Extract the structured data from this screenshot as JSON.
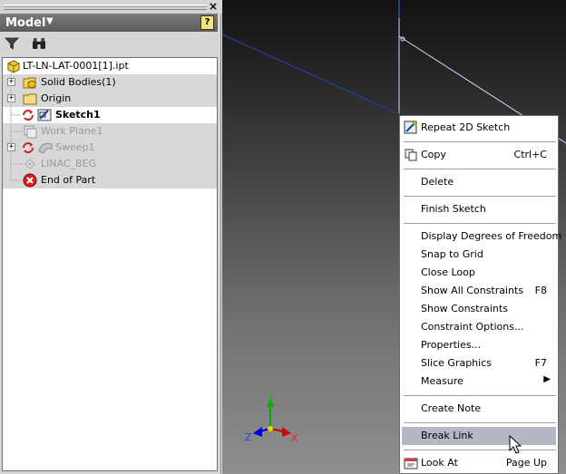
{
  "browser": {
    "title": "Model",
    "close_glyph": "×",
    "help_glyph": "?",
    "toolbar": [
      {
        "icon": "filter-icon"
      },
      {
        "icon": "find-binoculars-icon"
      }
    ],
    "tree": [
      {
        "label": "LT-LN-LAT-0001[1].ipt",
        "icon": "part-icon",
        "expander": false,
        "style": "normal"
      },
      {
        "label": "Solid Bodies(1)",
        "icon": "folder-solid-bodies-icon",
        "expander": true,
        "style": "normal"
      },
      {
        "label": "Origin",
        "icon": "folder-icon",
        "expander": true,
        "style": "normal"
      },
      {
        "label": "Sketch1",
        "icon": "sketch-icon",
        "expander": false,
        "style": "bold"
      },
      {
        "label": "Work Plane1",
        "icon": "work-plane-icon",
        "expander": false,
        "style": "grey"
      },
      {
        "label": "Sweep1",
        "icon": "sweep-icon",
        "expander": true,
        "style": "grey"
      },
      {
        "label": "LINAC_BEG",
        "icon": "work-point-icon",
        "expander": false,
        "style": "grey"
      },
      {
        "label": "End of Part",
        "icon": "end-of-part-icon",
        "expander": false,
        "style": "normal"
      }
    ]
  },
  "viewport": {
    "triad": {
      "x_label": "X",
      "y_label": "Y",
      "z_label": "Z"
    }
  },
  "context_menu": {
    "items": [
      {
        "label": "Repeat 2D Sketch",
        "underline": "R",
        "shortcut": "",
        "icon": "sketch-icon"
      },
      {
        "label": "Copy",
        "underline": "C",
        "shortcut": "Ctrl+C",
        "icon": "copy-icon"
      },
      {
        "label": "Delete",
        "underline": "D",
        "shortcut": "",
        "icon": ""
      },
      {
        "label": "Finish Sketch",
        "underline": "",
        "shortcut": "",
        "icon": ""
      },
      {
        "label": "Display Degrees of Freedom",
        "underline": "",
        "shortcut": "",
        "icon": ""
      },
      {
        "label": "Snap to Grid",
        "underline": "",
        "shortcut": "",
        "icon": ""
      },
      {
        "label": "Close Loop",
        "underline": "",
        "shortcut": "",
        "icon": ""
      },
      {
        "label": "Show All Constraints",
        "underline": "S",
        "shortcut": "F8",
        "icon": ""
      },
      {
        "label": "Show Constraints",
        "underline": "",
        "shortcut": "",
        "icon": ""
      },
      {
        "label": "Constraint Options...",
        "underline": "",
        "shortcut": "",
        "icon": ""
      },
      {
        "label": "Properties...",
        "underline": "",
        "shortcut": "",
        "icon": ""
      },
      {
        "label": "Slice Graphics",
        "underline": "",
        "shortcut": "F7",
        "icon": ""
      },
      {
        "label": "Measure",
        "underline": "M",
        "shortcut": "",
        "icon": "",
        "submenu": true
      },
      {
        "label": "Create Note",
        "underline": "C",
        "shortcut": "",
        "icon": ""
      },
      {
        "label": "Break Link",
        "underline": "B",
        "shortcut": "",
        "icon": "",
        "highlighted": true
      },
      {
        "label": "Look At",
        "underline": "L",
        "shortcut": "Page Up",
        "icon": "look-at-icon"
      }
    ]
  }
}
